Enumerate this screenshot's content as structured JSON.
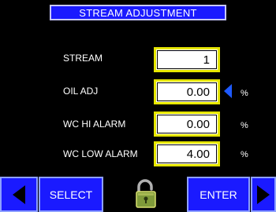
{
  "title": "STREAM ADJUSTMENT",
  "rows": [
    {
      "label": "STREAM",
      "value": "1",
      "unit": ""
    },
    {
      "label": "OIL ADJ",
      "value": "0.00",
      "unit": "%"
    },
    {
      "label": "WC HI ALARM",
      "value": "0.00",
      "unit": "%"
    },
    {
      "label": "WC LOW ALARM",
      "value": "4.00",
      "unit": "%"
    }
  ],
  "buttons": {
    "select": "SELECT",
    "enter": "ENTER"
  },
  "colors": {
    "accent_blue": "#1a1aff",
    "field_border": "#e6e600",
    "selector": "#1e5aff"
  },
  "icons": {
    "lock": "padlock-unlocked-icon",
    "prev": "left-arrow-icon",
    "next": "right-arrow-icon",
    "selector": "blue-selector-arrow-icon"
  }
}
